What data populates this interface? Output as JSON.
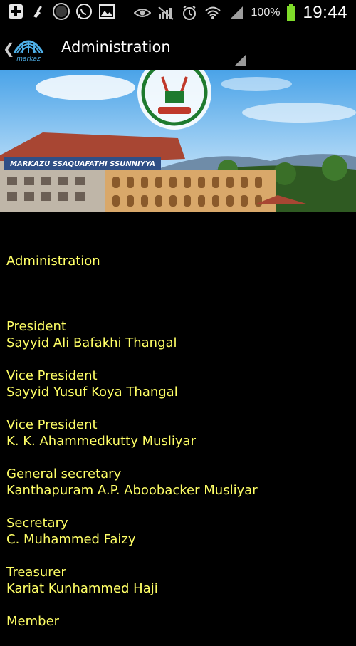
{
  "status_bar": {
    "icons": [
      "add-icon",
      "broom-icon",
      "badge-100-icon",
      "whatsapp-icon",
      "image-icon",
      "eye-icon",
      "no-signal-icon",
      "alarm-icon",
      "wifi-icon",
      "signal-icon"
    ],
    "badge_text": "100",
    "battery_percent": "100%",
    "time": "19:44"
  },
  "action_bar": {
    "logo_label": "markaz",
    "title": "Administration"
  },
  "banner": {
    "sign_text": "MARKAZU SSAQUAFATHI SSUNNIYYA"
  },
  "content": {
    "heading": "Administration",
    "roles": [
      {
        "role": "President",
        "name": "Sayyid Ali Bafakhi Thangal"
      },
      {
        "role": "Vice President",
        "name": "Sayyid Yusuf Koya Thangal"
      },
      {
        "role": "Vice President",
        "name": "K. K. Ahammedkutty Musliyar"
      },
      {
        "role": "General secretary",
        "name": "Kanthapuram A.P. Aboobacker Musliyar"
      },
      {
        "role": "Secretary",
        "name": "C. Muhammed Faizy"
      },
      {
        "role": "Treasurer",
        "name": "Kariat Kunhammed Haji"
      },
      {
        "role": "Member",
        "name": ""
      }
    ]
  },
  "colors": {
    "background": "#000000",
    "text_yellow": "#ffff66",
    "battery_green": "#7fdc2a"
  }
}
